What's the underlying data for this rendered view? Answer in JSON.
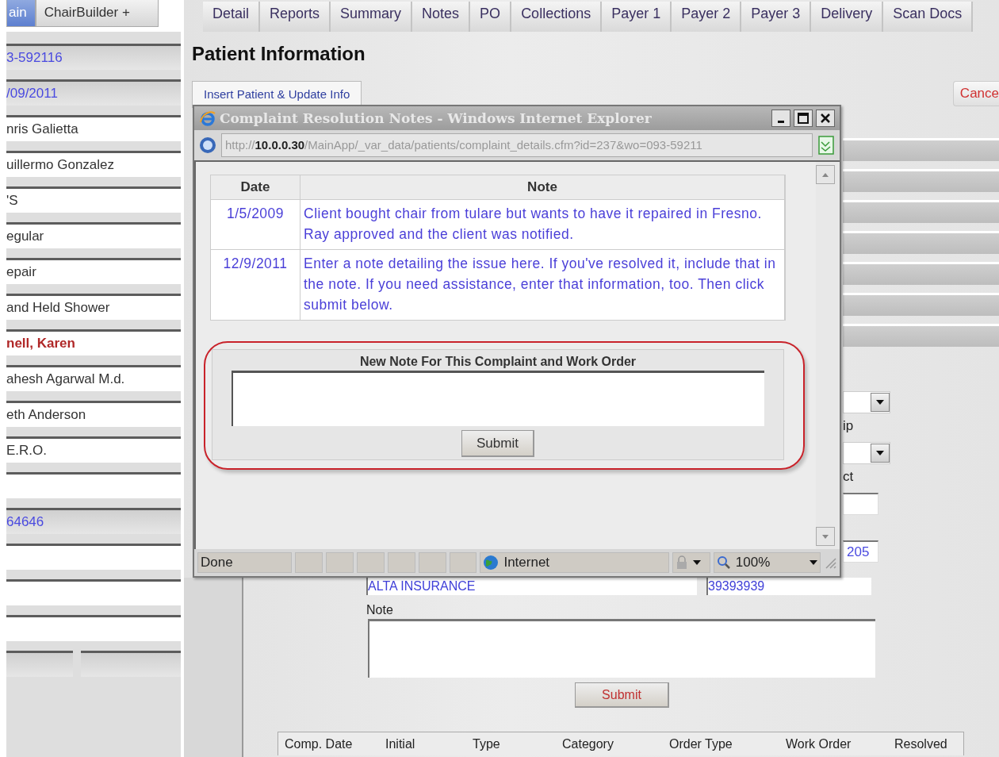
{
  "sidebar": {
    "tabs": [
      {
        "label": "ain",
        "selected": true
      },
      {
        "label": "ChairBuilder +",
        "selected": false
      }
    ],
    "fields": [
      {
        "kind": "id",
        "value": "3-592116"
      },
      {
        "kind": "id",
        "value": "/09/2011"
      },
      {
        "kind": "text",
        "value": "nris Galietta"
      },
      {
        "kind": "text",
        "value": "uillermo Gonzalez"
      },
      {
        "kind": "text",
        "value": "'S"
      },
      {
        "kind": "text",
        "value": "egular"
      },
      {
        "kind": "text",
        "value": "epair"
      },
      {
        "kind": "text",
        "value": "and Held Shower"
      },
      {
        "kind": "alert",
        "value": "nell, Karen"
      },
      {
        "kind": "text",
        "value": "ahesh Agarwal M.d."
      },
      {
        "kind": "text",
        "value": "eth Anderson"
      },
      {
        "kind": "text",
        "value": "E.R.O."
      },
      {
        "kind": "text"
      },
      {
        "kind": "id",
        "value": "64646"
      },
      {
        "kind": "text"
      },
      {
        "kind": "text"
      },
      {
        "kind": "text"
      },
      {
        "kind": "split"
      }
    ]
  },
  "tabs": [
    "Detail",
    "Reports",
    "Summary",
    "Notes",
    "PO",
    "Collections",
    "Payer 1",
    "Payer 2",
    "Payer 3",
    "Delivery",
    "Scan Docs"
  ],
  "page_title": "Patient Information",
  "insert_tab": {
    "label": "Insert Patient & Update Info",
    "selected": true
  },
  "cancel_button": "Cance",
  "side_form": [
    {
      "kind": "select"
    },
    {
      "kind": "label",
      "text": "ip"
    },
    {
      "kind": "select"
    },
    {
      "kind": "label",
      "text": "ct"
    },
    {
      "kind": "input"
    },
    {
      "kind": "input",
      "value": "205"
    }
  ],
  "popup": {
    "title": "Complaint Resolution Notes - Windows Internet Explorer",
    "url": "http://**10.0.0.30**/MainApp/_var_data/patients/complaint_details.cfm?id=237&wo=093-59211",
    "table": {
      "columns": [
        "Date",
        "Note"
      ],
      "rows": [
        {
          "date": "1/5/2009",
          "note": "Client bought chair from tulare but wants to have it repaired in Fresno. Ray approved and the client was notified."
        },
        {
          "date": "12/9/2011",
          "note": "Enter a note detailing the issue here. If you've resolved it, include that in the note. If you need assistance, enter that information, too. Then click submit below."
        }
      ]
    },
    "new_note": {
      "label": "New Note For This Complaint and Work Order",
      "button": "Submit"
    },
    "status": {
      "text": "Done",
      "zone": "Internet",
      "zoom": "100%"
    }
  },
  "form": {
    "insurance": "ALTA INSURANCE",
    "policy": "39393939",
    "note_label": "Note",
    "button": "Submit",
    "table_columns": [
      "Comp. Date",
      "Initial",
      "Type",
      "Category",
      "Order Type",
      "Work Order",
      "Resolved"
    ]
  }
}
